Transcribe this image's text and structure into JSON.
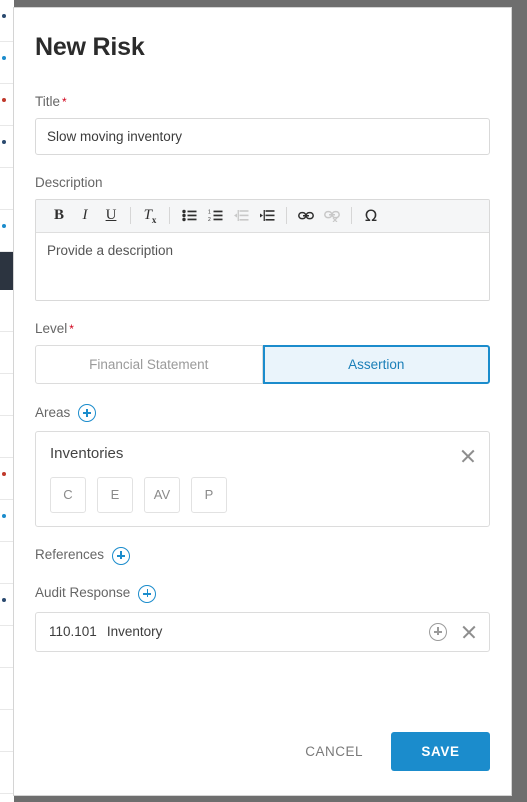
{
  "modal": {
    "title": "New Risk"
  },
  "title_field": {
    "label": "Title",
    "required_marker": "*",
    "value": "Slow moving inventory"
  },
  "description_field": {
    "label": "Description",
    "placeholder": "Provide a description",
    "toolbar": [
      {
        "name": "bold-icon",
        "glyph": "B",
        "enabled": true
      },
      {
        "name": "italic-icon",
        "glyph": "I",
        "enabled": true
      },
      {
        "name": "underline-icon",
        "glyph": "U",
        "enabled": true
      },
      {
        "name": "remove-format-icon",
        "glyph": "Tx",
        "enabled": true
      },
      {
        "name": "bulleted-list-icon",
        "glyph": "☰",
        "enabled": true
      },
      {
        "name": "numbered-list-icon",
        "glyph": "☰",
        "enabled": true
      },
      {
        "name": "decrease-indent-icon",
        "glyph": "☰",
        "enabled": false
      },
      {
        "name": "increase-indent-icon",
        "glyph": "☰",
        "enabled": true
      },
      {
        "name": "link-icon",
        "glyph": "⚭",
        "enabled": true
      },
      {
        "name": "unlink-icon",
        "glyph": "⚭",
        "enabled": false
      },
      {
        "name": "special-character-icon",
        "glyph": "Ω",
        "enabled": true
      }
    ]
  },
  "level_field": {
    "label": "Level",
    "required_marker": "*",
    "options": [
      {
        "label": "Financial Statement",
        "selected": false
      },
      {
        "label": "Assertion",
        "selected": true
      }
    ]
  },
  "areas_field": {
    "label": "Areas",
    "add_icon": "circle-plus-icon",
    "items": [
      {
        "name": "Inventories",
        "assertions": [
          "C",
          "E",
          "AV",
          "P"
        ]
      }
    ]
  },
  "references_field": {
    "label": "References",
    "add_icon": "circle-plus-icon"
  },
  "audit_response_field": {
    "label": "Audit Response",
    "add_icon": "circle-plus-icon",
    "items": [
      {
        "code": "110.101",
        "name": "Inventory"
      }
    ]
  },
  "footer": {
    "cancel_label": "CANCEL",
    "save_label": "SAVE"
  },
  "colors": {
    "accent": "#1b8ccc",
    "accent_fill": "#eaf4fb",
    "required": "#d0021b",
    "text": "#3b3b3b",
    "muted": "#9a9a9a",
    "border": "#dcdcdc",
    "backdrop": "#6e6e6e"
  }
}
